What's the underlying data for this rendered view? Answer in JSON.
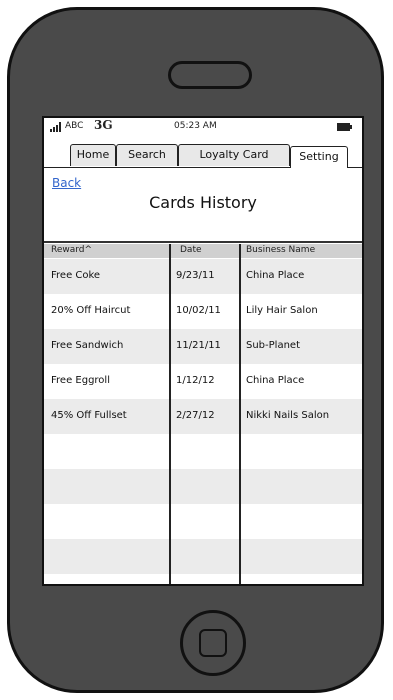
{
  "status_bar": {
    "carrier": "ABC",
    "network": "3G",
    "time": "05:23 AM"
  },
  "tabs": [
    {
      "label": "Home"
    },
    {
      "label": "Search"
    },
    {
      "label": "Loyalty Card"
    },
    {
      "label": "Setting",
      "active": true
    }
  ],
  "header": {
    "back_label": "Back",
    "title": "Cards History"
  },
  "table": {
    "columns": [
      "Reward^",
      "Date",
      "Business Name"
    ],
    "rows": [
      {
        "reward": "Free Coke",
        "date": "9/23/11",
        "business": "China Place"
      },
      {
        "reward": "20% Off Haircut",
        "date": "10/02/11",
        "business": "Lily Hair Salon"
      },
      {
        "reward": "Free Sandwich",
        "date": "11/21/11",
        "business": "Sub-Planet"
      },
      {
        "reward": "Free Eggroll",
        "date": "1/12/12",
        "business": "China Place"
      },
      {
        "reward": "45% Off Fullset",
        "date": "2/27/12",
        "business": "Nikki Nails Salon"
      }
    ]
  },
  "colors": {
    "link": "#3366cc",
    "phone_body": "#4a4a4a",
    "row_alt": "#ebebeb",
    "header_bg": "#d0d0d0"
  }
}
